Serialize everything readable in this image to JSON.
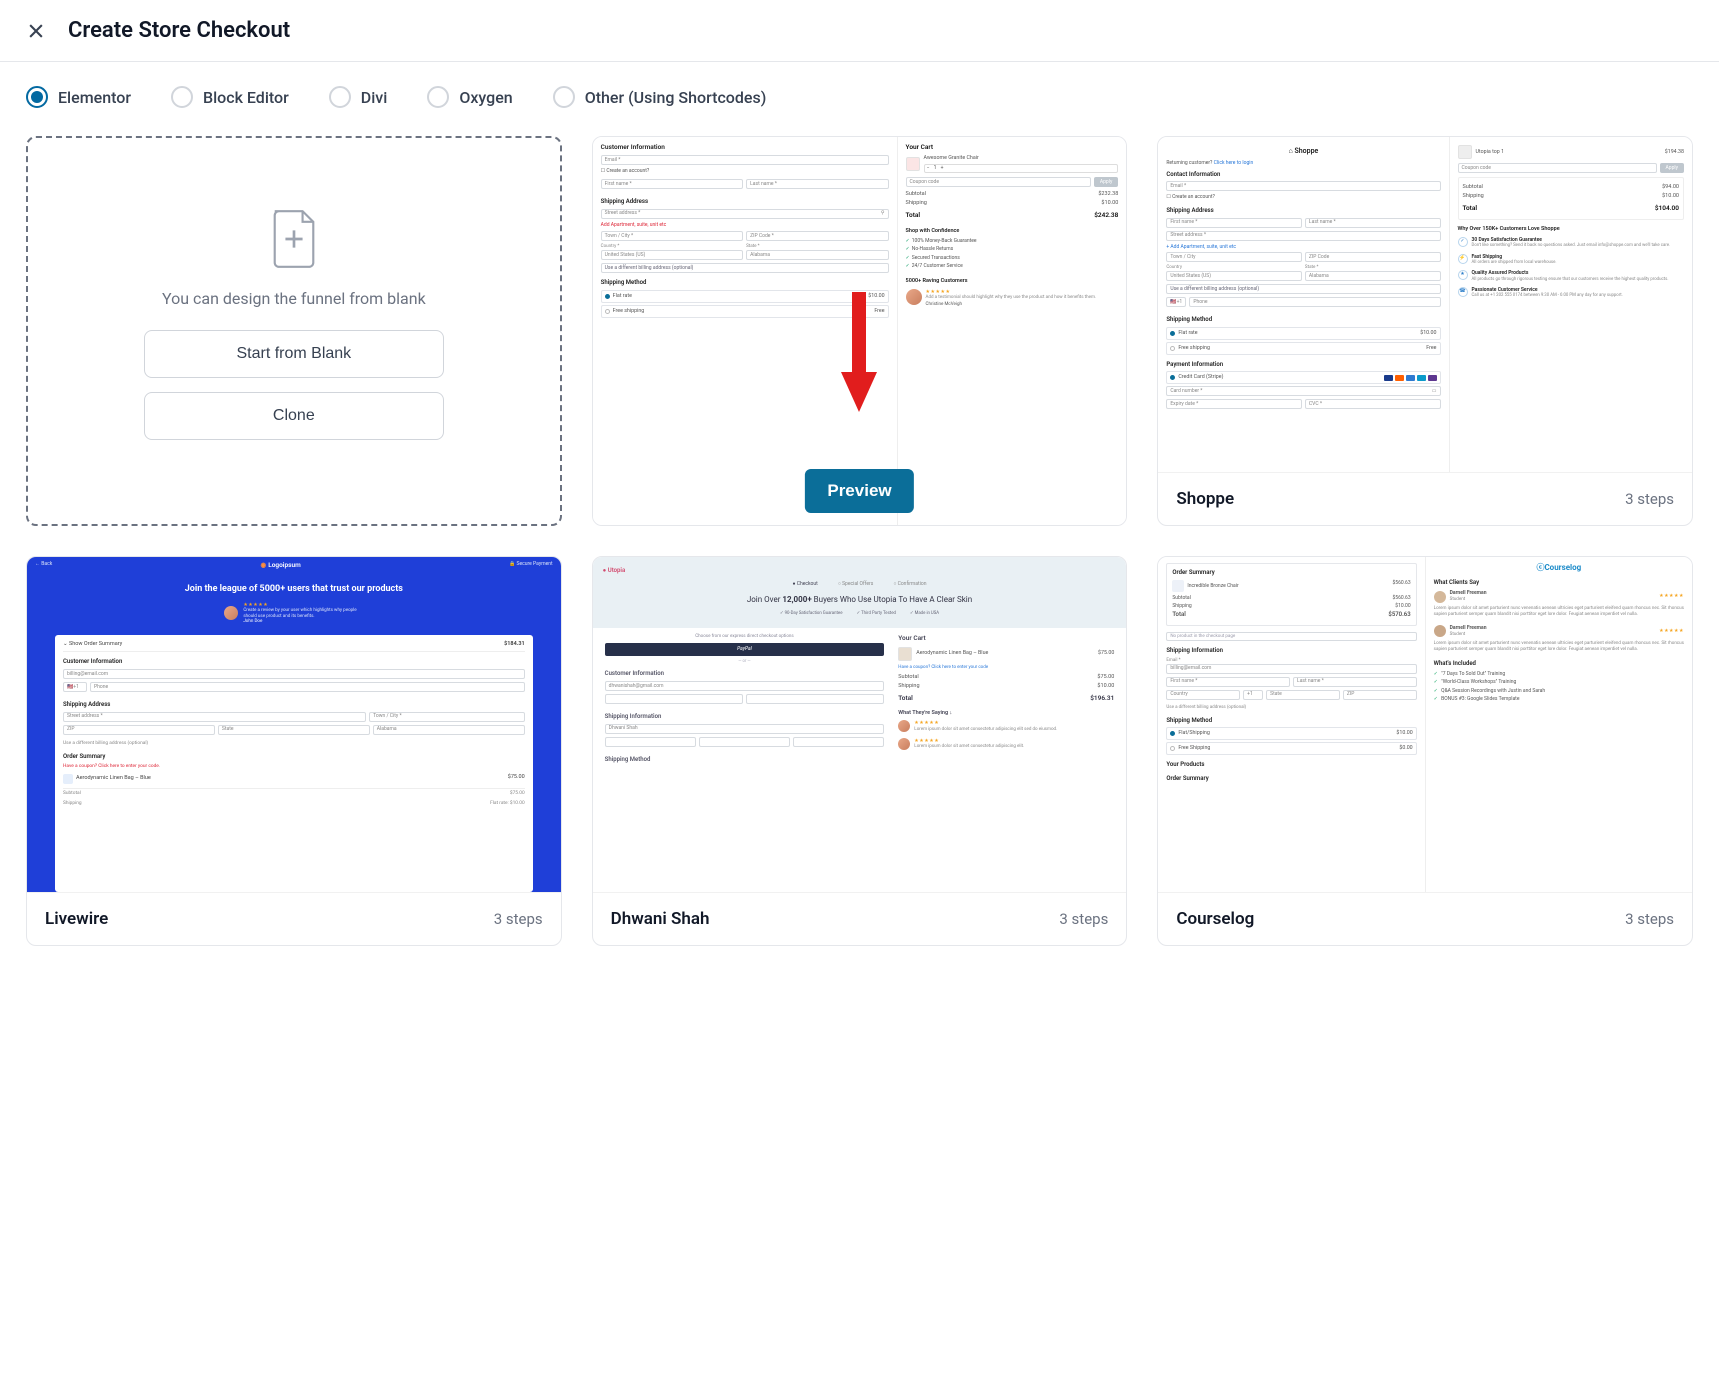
{
  "header": {
    "title": "Create Store Checkout"
  },
  "builders": [
    {
      "label": "Elementor",
      "selected": true
    },
    {
      "label": "Block Editor",
      "selected": false
    },
    {
      "label": "Divi",
      "selected": false
    },
    {
      "label": "Oxygen",
      "selected": false
    },
    {
      "label": "Other (Using Shortcodes)",
      "selected": false
    }
  ],
  "blank_card": {
    "text": "You can design the funnel from blank",
    "start_btn": "Start from Blank",
    "clone_btn": "Clone"
  },
  "preview_btn": "Preview",
  "templates": {
    "default": {
      "name": "",
      "steps": "",
      "left": {
        "section1": "Customer Information",
        "email_ph": "Email *",
        "create_acc": "Create an account?",
        "first_ph": "First name *",
        "last_ph": "Last name *",
        "section2": "Shipping Address",
        "street_ph": "Street address *",
        "apt_link": "Add Apartment, suite, unit etc",
        "town_ph": "Town / City *",
        "zip_ph": "ZIP Code *",
        "country_lbl": "Country *",
        "country_val": "United States (US)",
        "state_lbl": "State *",
        "state_val": "Alabama",
        "diffbill": "Use a different billing address (optional)",
        "section3": "Shipping Method",
        "flat": "Flat rate",
        "flat_price": "$10.00",
        "free": "Free shipping",
        "free_price": "Free"
      },
      "right": {
        "cart_hdr": "Your Cart",
        "item_name": "Awesome Granite Chair",
        "coupon_ph": "Coupon code",
        "apply": "Apply",
        "subtotal_lbl": "Subtotal",
        "subtotal_val": "$232.38",
        "ship_lbl": "Shipping",
        "ship_val": "$10.00",
        "total_lbl": "Total",
        "total_val": "$242.38",
        "trust_hdr": "Shop with Confidence",
        "trust1": "100% Money-Back Guarantee",
        "trust2": "No-Hassle Returns",
        "trust3": "Secured Transactions",
        "trust4": "24/7 Customer Service",
        "rave_hdr": "5000+ Raving Customers",
        "testi_text": "Add a testimonial should highlight why they use the product and how it benefits them.",
        "testi_name": "Christine McVeigh"
      }
    },
    "shoppe": {
      "name": "Shoppe",
      "steps": "3 steps",
      "logo": "Shoppe",
      "left": {
        "return": "Returning customer?",
        "login": "Click here to login",
        "contact": "Contact Information",
        "email_ph": "Email *",
        "create_acc": "Create an account?",
        "ship": "Shipping Address",
        "first_ph": "First name *",
        "last_ph": "Last name *",
        "street_ph": "Street address *",
        "apt_link": "+ Add Apartment, suite, unit etc",
        "town_ph": "Town / City",
        "zip_ph": "ZIP Code",
        "country_lbl": "Country",
        "country_val": "United States (US)",
        "state_lbl": "State *",
        "state_val": "Alabama",
        "diffbill": "Use a different billing address (optional)",
        "phone_cc": "+1",
        "phone_ph": "Phone",
        "method": "Shipping Method",
        "flat": "Flat rate",
        "flat_price": "$10.00",
        "free": "Free shipping",
        "free_price": "Free",
        "payment": "Payment Information",
        "cc": "Credit Card (Stripe)",
        "card_ph": "Card number *",
        "exp_ph": "Expiry date *",
        "cvc_ph": "CVC *"
      },
      "right": {
        "item": "Utopia top 1",
        "item_price": "$194.38",
        "coupon_ph": "Coupon code",
        "apply": "Apply",
        "sub_lbl": "Subtotal",
        "sub_val": "$94.00",
        "ship_lbl": "Shipping",
        "ship_val": "$10.00",
        "total_lbl": "Total",
        "total_val": "$104.00",
        "why_hdr": "Why Over 150K+ Customers Love Shoppe",
        "why1_t": "30 Days Satisfaction Guarantee",
        "why1_d": "Don't like something? Send it back no questions asked. Just email info@shoppe.com and we'll take care.",
        "why2_t": "Fast Shipping",
        "why2_d": "All orders are shipped from local warehouse.",
        "why3_t": "Quality Assured Products",
        "why3_d": "All products go through rigorous testing ensure that our customers receive the highest quality products.",
        "why4_t": "Passionate Customer Service",
        "why4_d": "Call us at +1 202 555 0174 between 9:30 AM - 6:00 PM any day for any support."
      }
    },
    "livewire": {
      "name": "Livewire",
      "steps": "3 steps",
      "back": "← Back",
      "logo": "Logoipsum",
      "secure": "🔒 Secure Payment",
      "headline": "Join the league of 5000+ users that trust our products",
      "stars": "★★★★★",
      "review": "Create a review by your user which highlights why people should use product and its benefits.",
      "reviewer": "John Doe",
      "show_sum": "Show Order Summary",
      "sum_val": "$184.31",
      "cust": "Customer Information",
      "email": "billing@email.com",
      "phone_cc": "+1",
      "phone_ph": "Phone",
      "ship": "Shipping Address",
      "addr_ph": "Street address *",
      "town_ph": "Town / City *",
      "zip_ph": "ZIP",
      "state_ph": "State",
      "state_val": "Alabama",
      "diffbill": "Use a different billing address (optional)",
      "order_sum": "Order Summary",
      "coupon_msg": "Have a coupon? Click here to enter your code.",
      "item": "Aerodynamic Linen Bag – Blue",
      "item_price": "$75.00",
      "sub_lbl": "Subtotal",
      "sub_val": "$75.00",
      "ship_lbl": "Shipping",
      "ship_val": "Flat rate: $10.00"
    },
    "utopia": {
      "name": "Dhwani Shah",
      "steps": "3 steps",
      "logo": "● Utopia",
      "step1": "Checkout",
      "step2": "Special Offers",
      "step3": "Confirmation",
      "headline_pre": "Join Over ",
      "headline_bold": "12,000+",
      "headline_post": " Buyers Who Use Utopia To Have A Clear Skin",
      "badge1": "✓ 90-Day Satisfaction Guarantee",
      "badge2": "✓ Third Party Tested",
      "badge3": "✓ Made in USA",
      "express": "Choose from our express direct checkout options",
      "paypal": "PayPal",
      "cust": "Customer Information",
      "email": "dhwanishah@gmail.com",
      "ship": "Shipping Information",
      "method": "Shipping Method",
      "cart_hdr": "Your Cart",
      "item": "Aerodynamic Linen Bag – Blue",
      "item_price": "$75.00",
      "coupon_link": "Have a coupon? Click here to enter your code",
      "sub_lbl": "Subtotal",
      "sub_val": "$75.00",
      "ship_lbl": "Shipping",
      "ship_val": "$10.00",
      "total_lbl": "Total",
      "total_val": "$196.31",
      "saying": "What They're Saying ↓",
      "r_stars": "★★★★★",
      "r1": "Lorem ipsum dolor sit amet consectetur adipiscing elit sed do eiusmod.",
      "r2": "Lorem ipsum dolor sit amet consectetur adipiscing elit."
    },
    "courselog": {
      "name": "Courselog",
      "steps": "3 steps",
      "logo": "Courselog",
      "box1": "Order Summary",
      "item": "Incredible Bronze Chair",
      "item_price": "$560.63",
      "sub_lbl": "Subtotal",
      "sub_val": "$560.63",
      "ship_lbl": "Shipping",
      "ship_val": "$10.00",
      "total_lbl": "Total",
      "total_val": "$570.63",
      "nop": "No product in the checkout page",
      "box2": "Shipping Information",
      "email_lbl": "Email *",
      "email": "billing@email.com",
      "first_ph": "First name *",
      "last_ph": "Last name *",
      "country_ph": "Country",
      "phone_cc": "+1",
      "state_ph": "State",
      "zip_ph": "ZIP",
      "diffbill": "Use a different billing address (optional)",
      "box3": "Shipping Method",
      "flat": "Flat/Shipping",
      "flat_p": "$10.00",
      "free": "Free Shipping",
      "free_p": "$0.00",
      "box4": "Your Products",
      "box5": "Order Summary",
      "clients_hdr": "What Clients Say",
      "c1_name": "Darnell Freeman",
      "c1_role": "Student",
      "stars": "★★★★★",
      "c1_text": "Lorem ipsum dolor sit amet parturient nunc venenatis aenean ultricies eget parturient eleifend quam rhoncus nec. Sit rhoncus sapien parturient semper quam blandit nisi porttitor eget lore dolor. Feugiat aenean imperdiet vel nulla.",
      "c2_name": "Darnell Freeman",
      "c2_role": "Student",
      "c2_text": "Lorem ipsum dolor sit amet parturient nunc venenatis aenean ultricies eget parturient eleifend quam rhoncus nec. Sit rhoncus sapien parturient semper quam blandit nisi porttitor eget lore dolor. Feugiat aenean imperdiet vel nulla.",
      "incl_hdr": "What's Included",
      "incl1": "\"7 Days To Sold Out\" Training",
      "incl2": "\"World-Class Workshops\" Training",
      "incl3": "Q&A Session Recordings with Justin and Sarah",
      "incl4": "BONUS #3: Google Slides Template"
    }
  }
}
